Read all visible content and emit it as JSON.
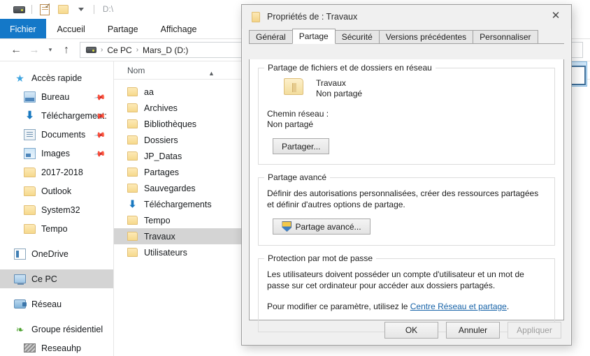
{
  "explorer": {
    "quick_access_toolbar": {
      "drive_icon": "drive-icon",
      "properties_icon": "properties-icon",
      "new_folder_icon": "new-folder-icon",
      "customize_icon": "chevron-down-icon",
      "path_label": "D:\\"
    },
    "ribbon_tabs": [
      {
        "label": "Fichier",
        "active": true
      },
      {
        "label": "Accueil",
        "active": false
      },
      {
        "label": "Partage",
        "active": false
      },
      {
        "label": "Affichage",
        "active": false
      }
    ],
    "navigation": {
      "back_icon": "arrow-left-icon",
      "forward_icon": "arrow-right-icon",
      "recent_icon": "chevron-down-icon",
      "up_icon": "arrow-up-icon",
      "breadcrumb": {
        "drive_icon": "drive-icon",
        "items": [
          "Ce PC",
          "Mars_D (D:)"
        ],
        "separator": "›"
      }
    },
    "nav_pane": [
      {
        "label": "Accès rapide",
        "icon": "star-icon",
        "indent": false,
        "pinned": false,
        "selected": false
      },
      {
        "label": "Bureau",
        "icon": "desktop-icon",
        "indent": true,
        "pinned": true,
        "selected": false
      },
      {
        "label": "Téléchargement:",
        "icon": "download-icon",
        "indent": true,
        "pinned": true,
        "selected": false
      },
      {
        "label": "Documents",
        "icon": "documents-icon",
        "indent": true,
        "pinned": true,
        "selected": false
      },
      {
        "label": "Images",
        "icon": "pictures-icon",
        "indent": true,
        "pinned": true,
        "selected": false
      },
      {
        "label": "2017-2018",
        "icon": "folder-icon",
        "indent": true,
        "pinned": false,
        "selected": false
      },
      {
        "label": "Outlook",
        "icon": "folder-icon",
        "indent": true,
        "pinned": false,
        "selected": false
      },
      {
        "label": "System32",
        "icon": "folder-icon",
        "indent": true,
        "pinned": false,
        "selected": false
      },
      {
        "label": "Tempo",
        "icon": "folder-icon",
        "indent": true,
        "pinned": false,
        "selected": false
      },
      {
        "label": "OneDrive",
        "icon": "onedrive-icon",
        "indent": false,
        "pinned": false,
        "selected": false
      },
      {
        "label": "Ce PC",
        "icon": "this-pc-icon",
        "indent": false,
        "pinned": false,
        "selected": true
      },
      {
        "label": "Réseau",
        "icon": "network-icon",
        "indent": false,
        "pinned": false,
        "selected": false
      },
      {
        "label": "Groupe résidentiel",
        "icon": "homegroup-icon",
        "indent": false,
        "pinned": false,
        "selected": false
      },
      {
        "label": "Reseauhp",
        "icon": "homegroup-computer-icon",
        "indent": true,
        "pinned": false,
        "selected": false
      }
    ],
    "file_list": {
      "column_header": "Nom",
      "sort_indicator": "chevron-up-icon",
      "rows": [
        {
          "name": "aa",
          "icon": "folder-icon",
          "selected": false
        },
        {
          "name": "Archives",
          "icon": "folder-icon",
          "selected": false
        },
        {
          "name": "Bibliothèques",
          "icon": "folder-icon",
          "selected": false
        },
        {
          "name": "Dossiers",
          "icon": "folder-icon",
          "selected": false
        },
        {
          "name": "JP_Datas",
          "icon": "folder-icon",
          "selected": false
        },
        {
          "name": "Partages",
          "icon": "folder-icon",
          "selected": false
        },
        {
          "name": "Sauvegardes",
          "icon": "folder-icon",
          "selected": false
        },
        {
          "name": "Téléchargements",
          "icon": "download-folder-icon",
          "selected": false
        },
        {
          "name": "Tempo",
          "icon": "folder-icon",
          "selected": false
        },
        {
          "name": "Travaux",
          "icon": "folder-icon",
          "selected": true
        },
        {
          "name": "Utilisateurs",
          "icon": "folder-icon",
          "selected": false
        }
      ]
    }
  },
  "dialog": {
    "title": "Propriétés de : Travaux",
    "title_icon": "folder-icon",
    "close_icon": "close-icon",
    "tabs": [
      {
        "label": "Général",
        "active": false
      },
      {
        "label": "Partage",
        "active": true
      },
      {
        "label": "Sécurité",
        "active": false
      },
      {
        "label": "Versions précédentes",
        "active": false
      },
      {
        "label": "Personnaliser",
        "active": false
      }
    ],
    "network_sharing": {
      "group_label": "Partage de fichiers et de dossiers en réseau",
      "folder_icon": "folder-icon",
      "folder_name": "Travaux",
      "folder_status": "Non partagé",
      "network_path_label": "Chemin réseau :",
      "network_path_value": "Non partagé",
      "share_button": "Partager..."
    },
    "advanced_sharing": {
      "group_label": "Partage avancé",
      "description": "Définir des autorisations personnalisées, créer des ressources partagées et définir d'autres options de partage.",
      "button_label": "Partage avancé...",
      "button_icon": "shield-icon"
    },
    "password_protection": {
      "group_label": "Protection par mot de passe",
      "description": "Les utilisateurs doivent posséder un compte d'utilisateur et un mot de passe sur cet ordinateur pour accéder aux dossiers partagés.",
      "link_prefix": "Pour modifier ce paramètre, utilisez le ",
      "link_text": "Centre Réseau et partage",
      "link_suffix": "."
    },
    "footer": {
      "ok": "OK",
      "cancel": "Annuler",
      "apply": "Appliquer",
      "apply_disabled": true
    }
  },
  "colors": {
    "accent_blue": "#1478c8",
    "selection_gray": "#d4d4d4",
    "link_blue": "#1763a8",
    "folder_yellow": "#f6d98c"
  }
}
